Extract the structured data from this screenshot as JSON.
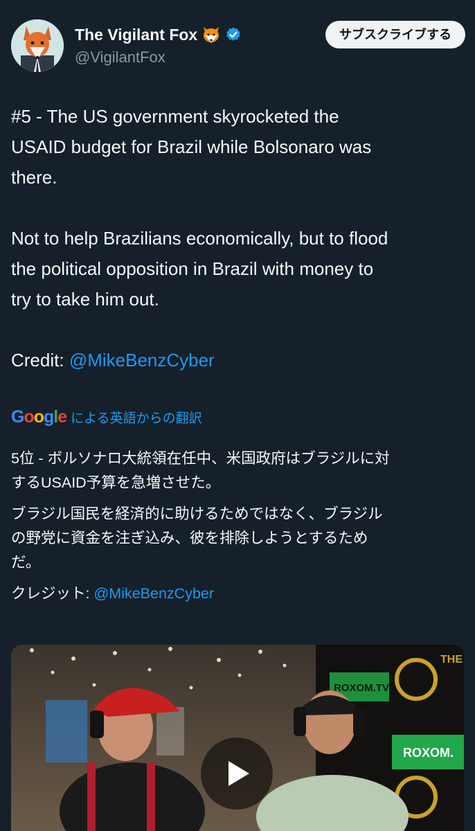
{
  "tweet": {
    "author": {
      "display_name": "The Vigilant Fox",
      "emoji": "fox-face",
      "verified": true,
      "handle": "@VigilantFox"
    },
    "subscribe_label": "サブスクライブする",
    "text": {
      "line1": "#5 - The US government skyrocketed the",
      "line2": "USAID budget for Brazil while Bolsonaro was",
      "line3": "there.",
      "line4": "Not to help Brazilians economically, but to flood",
      "line5": "the political opposition in Brazil with money to",
      "line6": "try to take him out.",
      "credit_label": "Credit: ",
      "credit_mention": "@MikeBenzCyber"
    },
    "translation": {
      "provider": "Google",
      "label": "による英語からの翻訳",
      "para1_line1": "5位 - ボルソナロ大統領在任中、米国政府はブラジルに対",
      "para1_line2": "するUSAID予算を急増させた。",
      "para2_line1": "ブラジル国民を経済的に助けるためではなく、ブラジル",
      "para2_line2": "の野党に資金を注ぎ込み、彼を排除しようとするため",
      "para2_line3": "だ。",
      "credit_label": "クレジット: ",
      "credit_mention": "@MikeBenzCyber"
    },
    "media": {
      "type": "video",
      "play_icon": "play-icon",
      "sign_text_1": "ROXOM.TV",
      "sign_text_2": "ROXOM.",
      "sign_text_3": "THE SHIN BLO"
    }
  },
  "colors": {
    "background": "#15202b",
    "text": "#f7f9f9",
    "secondary_text": "#8b98a5",
    "link": "#1d9bf0",
    "verified": "#1d9bf0"
  }
}
